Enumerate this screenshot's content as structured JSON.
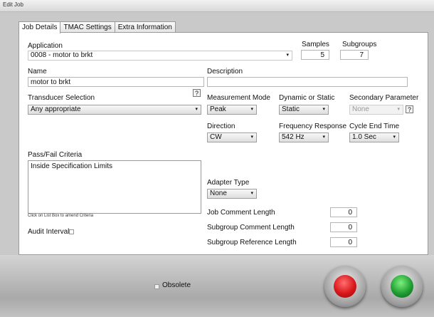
{
  "window": {
    "title": "Edit Job"
  },
  "tabs": [
    {
      "label": "Job Details",
      "active": true
    },
    {
      "label": "TMAC Settings",
      "active": false
    },
    {
      "label": "Extra Information",
      "active": false
    }
  ],
  "application": {
    "label": "Application",
    "value": "0008 - motor to brkt",
    "arrow": "▾"
  },
  "samples": {
    "label": "Samples",
    "value": "5"
  },
  "subgroups": {
    "label": "Subgroups",
    "value": "7"
  },
  "name": {
    "label": "Name",
    "value": "motor to brkt"
  },
  "description": {
    "label": "Description",
    "value": ""
  },
  "transducer": {
    "label": "Transducer Selection",
    "value": "Any appropriate",
    "help": "?"
  },
  "measurement_mode": {
    "label": "Measurement Mode",
    "value": "Peak"
  },
  "dynamic_static": {
    "label": "Dynamic or Static",
    "value": "Static"
  },
  "secondary_param": {
    "label": "Secondary Parameter",
    "value": "None",
    "help": "?"
  },
  "direction": {
    "label": "Direction",
    "value": "CW"
  },
  "frequency": {
    "label": "Frequency Response",
    "value": "542 Hz"
  },
  "cycle_end": {
    "label": "Cycle End Time",
    "value": "1.0 Sec"
  },
  "pass_fail": {
    "label": "Pass/Fail Criteria",
    "items": [
      "Inside Specification Limits"
    ],
    "hint": "Click on List Box to amend Criteria"
  },
  "adapter": {
    "label": "Adapter Type",
    "value": "None"
  },
  "job_comment": {
    "label": "Job Comment Length",
    "value": "0"
  },
  "subgroup_comment": {
    "label": "Subgroup Comment Length",
    "value": "0"
  },
  "subgroup_ref": {
    "label": "Subgroup Reference Length",
    "value": "0"
  },
  "audit": {
    "label": "Audit Interval"
  },
  "obsolete": {
    "label": "Obsolete"
  },
  "colors": {
    "cancel": "#d8161b",
    "ok": "#1f9e33"
  }
}
